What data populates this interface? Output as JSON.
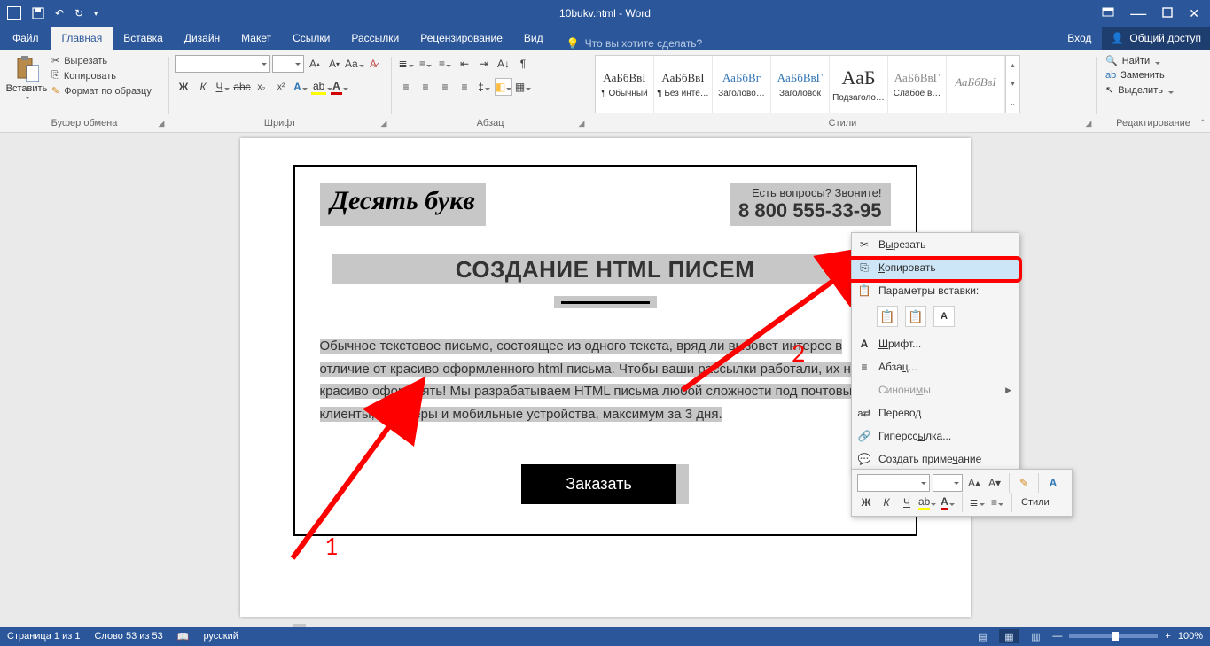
{
  "title": "10bukv.html - Word",
  "tabs": {
    "file": "Файл",
    "home": "Главная",
    "insert": "Вставка",
    "design": "Дизайн",
    "layout": "Макет",
    "references": "Ссылки",
    "mailings": "Рассылки",
    "review": "Рецензирование",
    "view": "Вид"
  },
  "help_placeholder": "Что вы хотите сделать?",
  "login": "Вход",
  "share": "Общий доступ",
  "clipboard": {
    "paste": "Вставить",
    "cut": "Вырезать",
    "copy": "Копировать",
    "fmt": "Формат по образцу",
    "label": "Буфер обмена"
  },
  "font": {
    "name": "",
    "size": "",
    "label": "Шрифт"
  },
  "paragraph": {
    "label": "Абзац"
  },
  "styles": {
    "label": "Стили",
    "items": [
      {
        "prev": "АаБбВвІ",
        "name": "¶ Обычный"
      },
      {
        "prev": "АаБбВвІ",
        "name": "¶ Без инте…"
      },
      {
        "prev": "АаБбВг",
        "name": "Заголово…"
      },
      {
        "prev": "АаБбВвГ",
        "name": "Заголовок"
      },
      {
        "prev": "АаБ",
        "name": "Подзаголо…"
      },
      {
        "prev": "АаБбВвГ",
        "name": "Слабое в…"
      },
      {
        "prev": "АаБбВвI",
        "name": ""
      }
    ]
  },
  "editing": {
    "find": "Найти",
    "replace": "Заменить",
    "select": "Выделить",
    "label": "Редактирование"
  },
  "doc": {
    "logo": "Десять букв",
    "q": "Есть вопросы? Звоните!",
    "phone": "8 800 555-33-95",
    "h1": "СОЗДАНИЕ HTML ПИСЕМ",
    "body": "Обычное текстовое письмо, состоящее из одного текста, вряд ли вызовет интерес в отличие от красиво оформленного html письма. Чтобы ваши рассылки работали, их нужно красиво оформлять! Мы разрабатываем HTML письма любой сложности под почтовые клиенты, браузеры и мобильные устройства, максимум за 3 дня.",
    "order": "Заказать"
  },
  "context": {
    "cut": "Вырезать",
    "copy": "Копировать",
    "paste_opts": "Параметры вставки:",
    "font": "Шрифт...",
    "para": "Абзац...",
    "syn": "Синонимы",
    "trans": "Перевод",
    "link": "Гиперссылка...",
    "comment": "Создать примечание"
  },
  "mini": {
    "styles": "Стили"
  },
  "status": {
    "page": "Страница 1 из 1",
    "words": "Слово 53 из 53",
    "lang": "русский",
    "zoom": "100%"
  },
  "annot": {
    "n1": "1",
    "n2": "2"
  }
}
